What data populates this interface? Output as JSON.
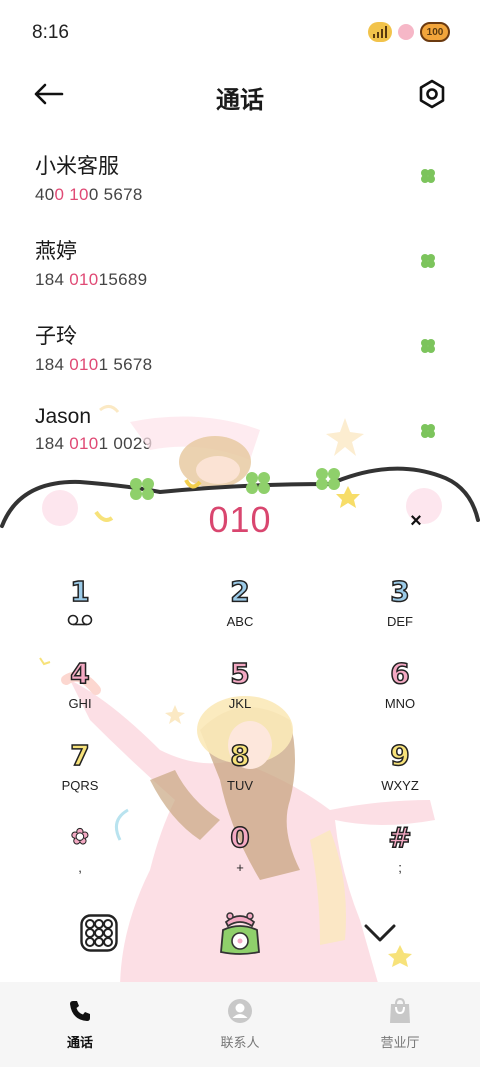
{
  "status": {
    "time": "8:16",
    "battery": "100"
  },
  "header": {
    "title": "通话"
  },
  "contacts": [
    {
      "name": "小米客服",
      "number_parts": [
        "40",
        "0 ",
        "10",
        "0 5678"
      ]
    },
    {
      "name": "燕婷",
      "number_parts": [
        "184 ",
        "010",
        "15689"
      ]
    },
    {
      "name": "子玲",
      "number_parts": [
        "184 ",
        "010",
        "1 5678"
      ]
    },
    {
      "name": "Jason",
      "number_parts": [
        "184 ",
        "010",
        "1 0029"
      ]
    }
  ],
  "dialer": {
    "number": "010",
    "clear_symbol": "×"
  },
  "keypad": {
    "keys": [
      {
        "digit": "1",
        "sub": "ᴏᴏ",
        "color": "#9ccbe8"
      },
      {
        "digit": "2",
        "sub": "ABC",
        "color": "#9ccbe8"
      },
      {
        "digit": "3",
        "sub": "DEF",
        "color": "#9ccbe8"
      },
      {
        "digit": "4",
        "sub": "GHI",
        "color": "#f4a9c3"
      },
      {
        "digit": "5",
        "sub": "JKL",
        "color": "#f4a9c3"
      },
      {
        "digit": "6",
        "sub": "MNO",
        "color": "#f4a9c3"
      },
      {
        "digit": "7",
        "sub": "PQRS",
        "color": "#f7e27a"
      },
      {
        "digit": "8",
        "sub": "TUV",
        "color": "#f7e27a"
      },
      {
        "digit": "9",
        "sub": "WXYZ",
        "color": "#f7e27a"
      },
      {
        "digit": "✿",
        "sub": ",",
        "color": "#f4a9c3"
      },
      {
        "digit": "0",
        "sub": "+",
        "color": "#f4a9c3"
      },
      {
        "digit": "#",
        "sub": ";",
        "color": "#f4a9c3"
      }
    ]
  },
  "nav": {
    "items": [
      {
        "label": "通话",
        "icon": "phone-icon",
        "active": true
      },
      {
        "label": "联系人",
        "icon": "person-icon",
        "active": false
      },
      {
        "label": "营业厅",
        "icon": "shop-icon",
        "active": false
      }
    ]
  },
  "colors": {
    "accent": "#d9466f",
    "clover": "#7cc45c"
  }
}
